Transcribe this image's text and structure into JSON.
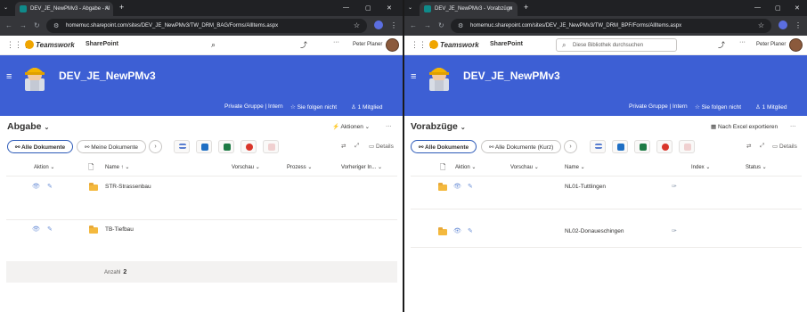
{
  "left": {
    "tab_title": "DEV_JE_NewPMv3 - Abgabe - Al",
    "url": "homemuc.sharepoint.com/sites/DEV_JE_NewPMv3/TW_DRM_BAG/Forms/AllItems.aspx",
    "brand": "Teamswork",
    "app_name": "SharePoint",
    "user_name": "Peter Planer",
    "more": "···",
    "site_title": "DEV_JE_NewPMv3",
    "privacy": "Private Gruppe | Intern",
    "follow": "Sie folgen nicht",
    "members": "1 Mitglied",
    "library_title": "Abgabe",
    "actions_label": "Aktionen",
    "views": [
      "Alle Dokumente",
      "Meine Dokumente"
    ],
    "details": "Details",
    "columns": [
      "Aktion",
      "Name",
      "Vorschau",
      "Prozess",
      "Vorheriger In..."
    ],
    "rows": [
      {
        "name": "STR-Strassenbau"
      },
      {
        "name": "TB-Tiefbau"
      }
    ],
    "footer_label": "Anzahl",
    "footer_count": "2"
  },
  "right": {
    "tab_title": "DEV_JE_NewPMv3 - Vorabzüge",
    "url": "homemuc.sharepoint.com/sites/DEV_JE_NewPMv3/TW_DRM_BPF/Forms/AllItems.aspx",
    "brand": "Teamswork",
    "app_name": "SharePoint",
    "search_placeholder": "Diese Bibliothek durchsuchen",
    "user_name": "Peter Planer",
    "more": "···",
    "site_title": "DEV_JE_NewPMv3",
    "privacy": "Private Gruppe | Intern",
    "follow": "Sie folgen nicht",
    "members": "1 Mitglied",
    "library_title": "Vorabzüge",
    "export_label": "Nach Excel exportieren",
    "views": [
      "Alle Dokumente",
      "Alle Dokumente (Kurz)"
    ],
    "details": "Details",
    "columns": [
      "Aktion",
      "Vorschau",
      "Name",
      "Index",
      "Status"
    ],
    "rows": [
      {
        "name": "NL01-Tuttlingen"
      },
      {
        "name": "NL02-Donaueschingen"
      }
    ]
  },
  "colors": {
    "header_blue": "#3d5fd4",
    "folder": "#f4b93e",
    "accent": "#2c5ab8"
  }
}
